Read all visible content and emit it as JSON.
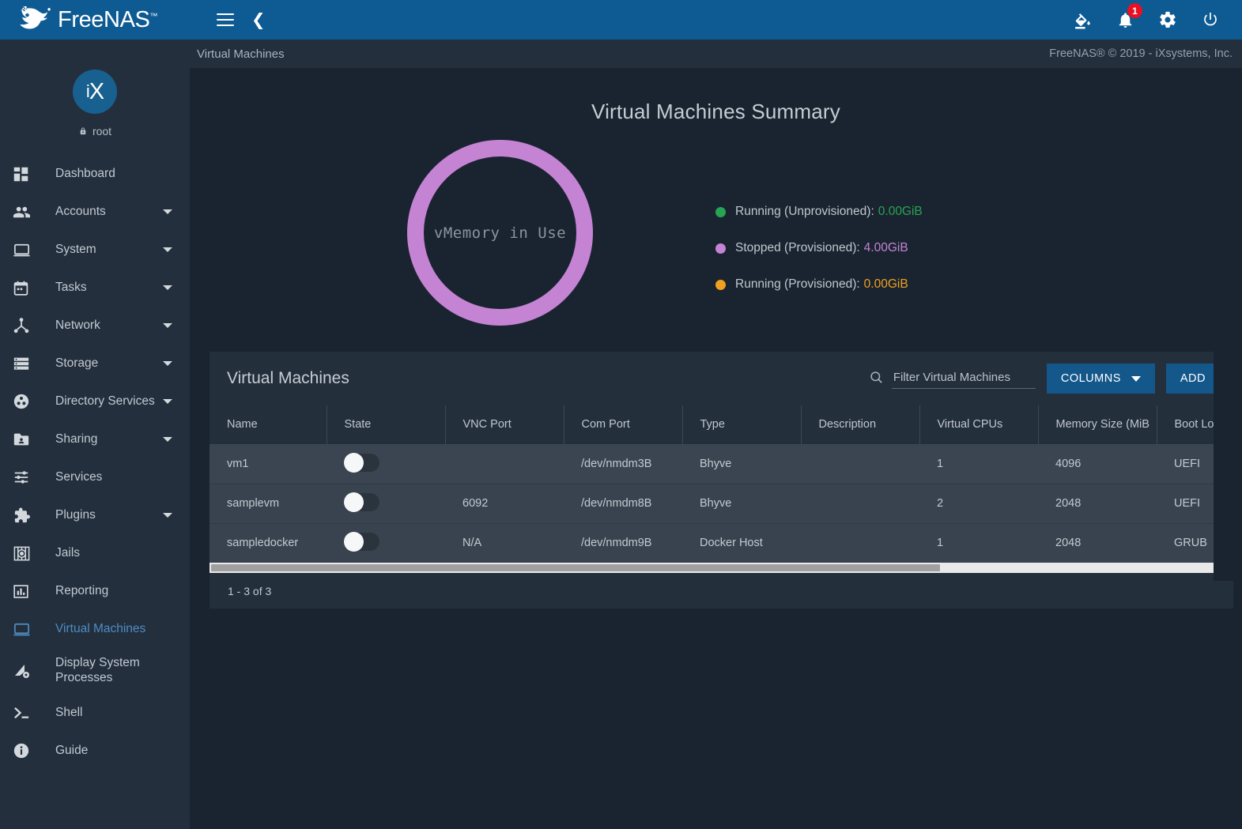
{
  "brand": {
    "name": "FreeNAS",
    "tm": "™",
    "logo_icon": "freenas-fish-logo"
  },
  "topbar": {
    "menu_icon": "hamburger-menu-icon",
    "collapse_icon": "chevron-left-icon",
    "theme_icon": "paint-bucket-icon",
    "alerts_icon": "bell-icon",
    "alerts_badge": "1",
    "settings_icon": "gear-icon",
    "power_icon": "power-icon"
  },
  "sidebar": {
    "avatar_i": "i",
    "avatar_x": "X",
    "lock_icon": "lock-icon",
    "username": "root",
    "items": [
      {
        "label": "Dashboard",
        "icon": "dashboard-icon",
        "caret": false,
        "active": false
      },
      {
        "label": "Accounts",
        "icon": "accounts-icon",
        "caret": true,
        "active": false
      },
      {
        "label": "System",
        "icon": "system-icon",
        "caret": true,
        "active": false
      },
      {
        "label": "Tasks",
        "icon": "tasks-calendar-icon",
        "caret": true,
        "active": false
      },
      {
        "label": "Network",
        "icon": "network-icon",
        "caret": true,
        "active": false
      },
      {
        "label": "Storage",
        "icon": "storage-icon",
        "caret": true,
        "active": false
      },
      {
        "label": "Directory Services",
        "icon": "directory-services-icon",
        "caret": true,
        "active": false
      },
      {
        "label": "Sharing",
        "icon": "sharing-folder-icon",
        "caret": true,
        "active": false
      },
      {
        "label": "Services",
        "icon": "services-sliders-icon",
        "caret": false,
        "active": false
      },
      {
        "label": "Plugins",
        "icon": "plugins-puzzle-icon",
        "caret": true,
        "active": false
      },
      {
        "label": "Jails",
        "icon": "jails-icon",
        "caret": false,
        "active": false
      },
      {
        "label": "Reporting",
        "icon": "reporting-chart-icon",
        "caret": false,
        "active": false
      },
      {
        "label": "Virtual Machines",
        "icon": "virtual-machines-icon",
        "caret": false,
        "active": true
      },
      {
        "label": "Display System Processes",
        "icon": "display-processes-icon",
        "caret": false,
        "active": false
      },
      {
        "label": "Shell",
        "icon": "shell-prompt-icon",
        "caret": false,
        "active": false
      },
      {
        "label": "Guide",
        "icon": "guide-info-icon",
        "caret": false,
        "active": false
      }
    ]
  },
  "breadcrumb": "Virtual Machines",
  "copyright": "FreeNAS® © 2019 - iXsystems, Inc.",
  "page_title": "Virtual Machines Summary",
  "chart_data": {
    "type": "pie",
    "title": "vMemory in Use",
    "center_label": "vMemory in Use",
    "legend_position": "right",
    "categories": [
      "Running (Unprovisioned)",
      "Stopped (Provisioned)",
      "Running (Provisioned)"
    ],
    "values": [
      0.0,
      4.0,
      0.0
    ],
    "value_labels": [
      "0.00GiB",
      "4.00GiB",
      "0.00GiB"
    ],
    "unit": "GiB",
    "colors": [
      "#27a453",
      "#c583d4",
      "#f0a01e"
    ],
    "legend": [
      {
        "label": "Running (Unprovisioned):",
        "value": "0.00GiB",
        "color": "#27a453"
      },
      {
        "label": "Stopped (Provisioned):",
        "value": "4.00GiB",
        "color": "#c583d4"
      },
      {
        "label": "Running (Provisioned):",
        "value": "0.00GiB",
        "color": "#f0a01e"
      }
    ]
  },
  "table_card": {
    "title": "Virtual Machines",
    "search": {
      "placeholder": "Filter Virtual Machines",
      "value": ""
    },
    "columns_button": "COLUMNS",
    "add_button": "ADD",
    "search_icon": "search-icon",
    "columns": [
      "Name",
      "State",
      "VNC Port",
      "Com Port",
      "Type",
      "Description",
      "Virtual CPUs",
      "Memory Size (MiB",
      "Boot Loa"
    ],
    "rows": [
      {
        "name": "vm1",
        "state": "off",
        "vnc_port": "",
        "com_port": "/dev/nmdm3B",
        "type": "Bhyve",
        "description": "",
        "vcpus": "1",
        "memory": "4096",
        "boot": "UEFI"
      },
      {
        "name": "samplevm",
        "state": "off",
        "vnc_port": "6092",
        "com_port": "/dev/nmdm8B",
        "type": "Bhyve",
        "description": "",
        "vcpus": "2",
        "memory": "2048",
        "boot": "UEFI"
      },
      {
        "name": "sampledocker",
        "state": "off",
        "vnc_port": "N/A",
        "com_port": "/dev/nmdm9B",
        "type": "Docker Host",
        "description": "",
        "vcpus": "1",
        "memory": "2048",
        "boot": "GRUB"
      }
    ],
    "footer": "1 - 3 of 3"
  }
}
